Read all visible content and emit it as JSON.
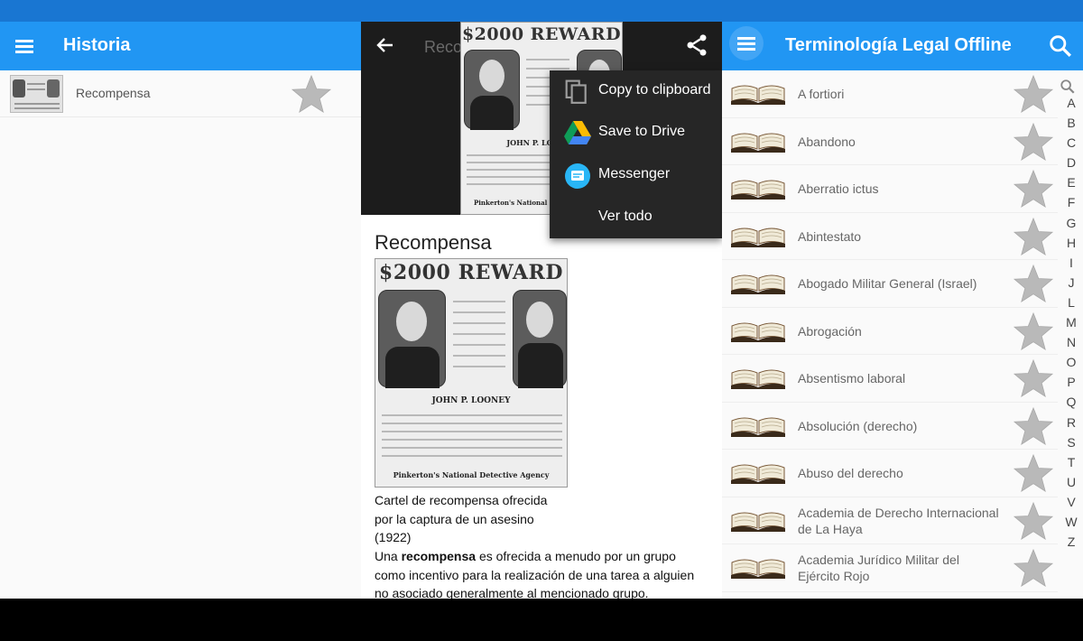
{
  "historia": {
    "title": "Historia",
    "items": [
      {
        "label": "Recompensa"
      }
    ]
  },
  "articulo": {
    "back_title": "Recompensa",
    "poster": {
      "headline": "$2000 REWARD",
      "name": "JOHN P. LOONEY",
      "agency": "Pinkerton's National Detective Agency"
    },
    "share_menu": {
      "items": [
        {
          "label": "Copy to clipboard",
          "icon": "copy-icon"
        },
        {
          "label": "Save to Drive",
          "icon": "drive-icon"
        },
        {
          "label": "Messenger",
          "icon": "messenger-icon"
        },
        {
          "label": "Ver todo"
        }
      ]
    },
    "title": "Recompensa",
    "caption_lines": [
      "Cartel de recompensa ofrecida",
      "por la captura de un asesino",
      "(1922)"
    ],
    "body": {
      "before": "Una ",
      "bold": "recompensa",
      "after_lines": [
        " es ofrecida a menudo por un grupo",
        "como incentivo para la realización de una tarea a alguien",
        "no asociado generalmente al mencionado grupo."
      ]
    }
  },
  "terminologia": {
    "title": "Terminología Legal Offline",
    "terms": [
      [
        "A fortiori"
      ],
      [
        "Abandono"
      ],
      [
        "Aberratio ictus"
      ],
      [
        "Abintestato"
      ],
      [
        "Abogado Militar General (Israel)"
      ],
      [
        "Abrogación"
      ],
      [
        "Absentismo laboral"
      ],
      [
        "Absolución (derecho)"
      ],
      [
        "Abuso del derecho"
      ],
      [
        "Academia de Derecho Internacional",
        "de La Haya"
      ],
      [
        "Academia Jurídico Militar del",
        "Ejército Rojo"
      ]
    ],
    "alphabet": [
      "A",
      "B",
      "C",
      "D",
      "E",
      "F",
      "G",
      "H",
      "I",
      "J",
      "L",
      "M",
      "N",
      "O",
      "P",
      "Q",
      "R",
      "S",
      "T",
      "U",
      "V",
      "W",
      "Z"
    ]
  },
  "colors": {
    "appbar": "#2196f3",
    "statusbar": "#1976d2",
    "star": "#bdbdbd"
  }
}
